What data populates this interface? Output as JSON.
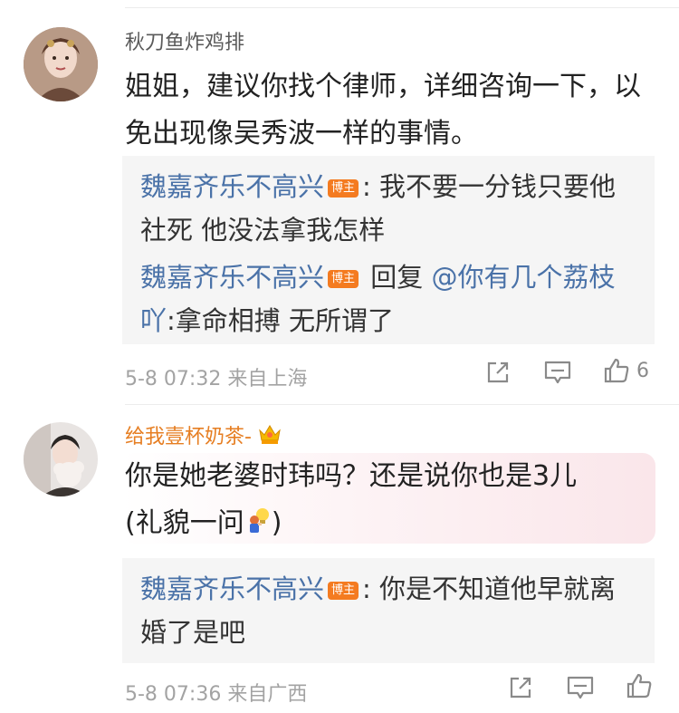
{
  "comments": [
    {
      "username": "秋刀鱼炸鸡排",
      "text": "姐姐，建议你找个律师，详细咨询一下，以免出现像吴秀波一样的事情。",
      "replies": [
        {
          "user": "魏嘉齐乐不高兴",
          "badge": "博主",
          "text": ": 我不要一分钱只要他社死 他没法拿我怎样"
        },
        {
          "user": "魏嘉齐乐不高兴",
          "badge": "博主",
          "prefix": " 回复 ",
          "mention": "@你有几个荔枝吖",
          "text": ":拿命相搏 无所谓了"
        }
      ],
      "meta": "5-8 07:32 来自上海",
      "likes": "6"
    },
    {
      "username": "给我壹杯奶茶-",
      "text_line1": "你是她老婆时玮吗？还是说你也是3儿",
      "text_line2_before": "(礼貌一问",
      "text_line2_after": ")",
      "replies": [
        {
          "user": "魏嘉齐乐不高兴",
          "badge": "博主",
          "text": ": 你是不知道他早就离婚了是吧"
        }
      ],
      "meta": "5-8 07:36 来自广西",
      "likes": ""
    }
  ],
  "icons": {
    "share": "share-icon",
    "comment": "comment-icon",
    "like": "thumbs-up-icon",
    "crown": "crown-icon",
    "emoji": "lightbulb-person-emoji"
  },
  "colors": {
    "reply_user": "#4a72a8",
    "badge": "#f47b20",
    "vip_name": "#e67e22"
  }
}
